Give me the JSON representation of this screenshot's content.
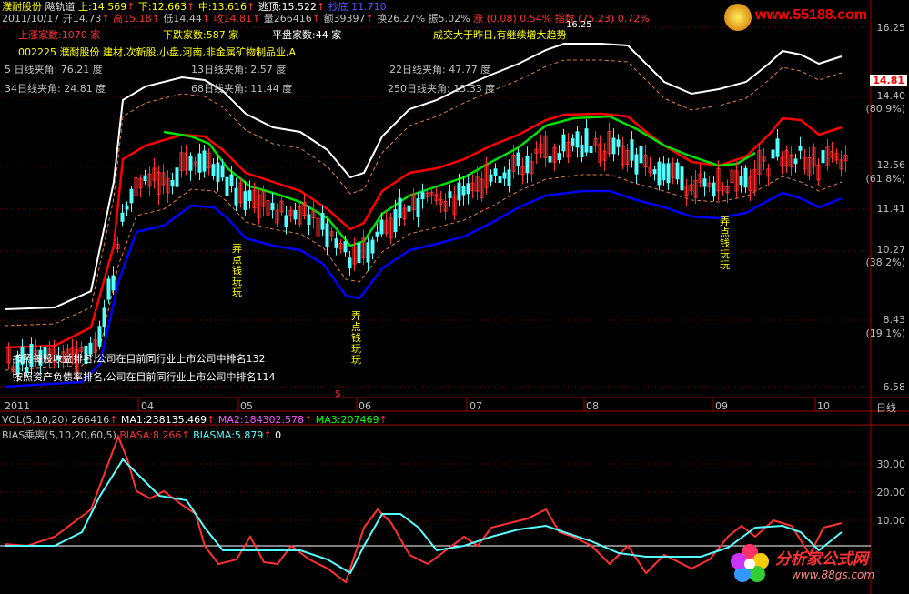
{
  "header": {
    "stock_name": "濮耐股份",
    "indicator_name": "飚轨道",
    "up_label": "上:14.569",
    "down_label": "下:12.663",
    "mid_label": "中:13.616",
    "top_label": "逃顶:15.522",
    "extra_label": "抄底 11.710",
    "date": "2011/10/17",
    "open": "开14.73",
    "high": "高15.18",
    "low": "低14.44",
    "close": "收14.81",
    "volume": "量266416",
    "amount": "额39397",
    "turnover": "换26.27%",
    "amplitude": "振5.02%",
    "change": "涨 (0.08) 0.54%",
    "index": "指数 (75.23) 0.72%"
  },
  "market_stats": {
    "up_count": "上涨家数:1070 家",
    "down_count": "下跌家数:587 家",
    "flat_count": "平盘家数:44 家",
    "note": "成交大于昨日,有继续增大趋势"
  },
  "info": {
    "industry": "002225 濮耐股份 建材,次新股,小盘,河南,非金属矿物制品业,A",
    "angle_5": "5 日线夹角: 76.21 度",
    "angle_13": "13日线夹角: 2.57 度",
    "angle_22": "22日线夹角: 47.77 度",
    "angle_34": "34日线夹角: 24.81 度",
    "angle_68": "68日线夹角: 11.44 度",
    "angle_250": "250日线夹角: 13.33 度",
    "rank_eps": "按照每股收益排名,公司在目前同行业上市公司中排名132",
    "rank_debt": "按照资产负债率排名,公司在目前同行业上市公司中排名114"
  },
  "annotations": {
    "text1": "弄点钱玩玩",
    "peak_label": "16.25"
  },
  "price_axis": {
    "labels": [
      "16.25",
      "14.40",
      "12.56",
      "11.41",
      "10.27",
      "8.43",
      "6.58"
    ],
    "pct_labels": [
      "(80.9%)",
      "(61.8%)",
      "(38.2%)",
      "(19.1%)"
    ],
    "current": "14.81"
  },
  "time_axis": {
    "labels": [
      "2011",
      "04",
      "05",
      "06",
      "07",
      "08",
      "09",
      "10"
    ],
    "period": "日线",
    "marker": "S"
  },
  "volume_bar": {
    "label": "VOL(5,10,20)",
    "value": "266416",
    "ma1": "MA1:238135.469",
    "ma2": "MA2:184302.578",
    "ma3": "MA3:207469"
  },
  "bias_panel": {
    "label": "BIAS乘离(5,10,20,60,5)",
    "bias": "BIASA:8.266",
    "biasma": "BIASMA:5.879",
    "zero": "0",
    "axis": [
      "30.00",
      "20.00",
      "10.00"
    ]
  },
  "watermark": {
    "top_site": "www.55188.com",
    "bottom_brand": "分析家公式网",
    "bottom_site": "www.88gs.com"
  },
  "colors": {
    "up": "#ff3030",
    "down": "#54ffff",
    "white_band": "#ffffff",
    "red_line": "#ff0000",
    "green_line": "#00e000",
    "blue_line": "#0000ff",
    "yellow": "#ffff00",
    "grid": "#800000"
  },
  "chart_data": {
    "type": "line",
    "x": [
      "2011",
      "04",
      "05",
      "06",
      "07",
      "08",
      "09",
      "10"
    ],
    "ylim": [
      6.58,
      16.25
    ],
    "series": [
      {
        "name": "上",
        "values": [
          14.569
        ]
      },
      {
        "name": "下",
        "values": [
          12.663
        ]
      },
      {
        "name": "中",
        "values": [
          13.616
        ]
      }
    ]
  }
}
